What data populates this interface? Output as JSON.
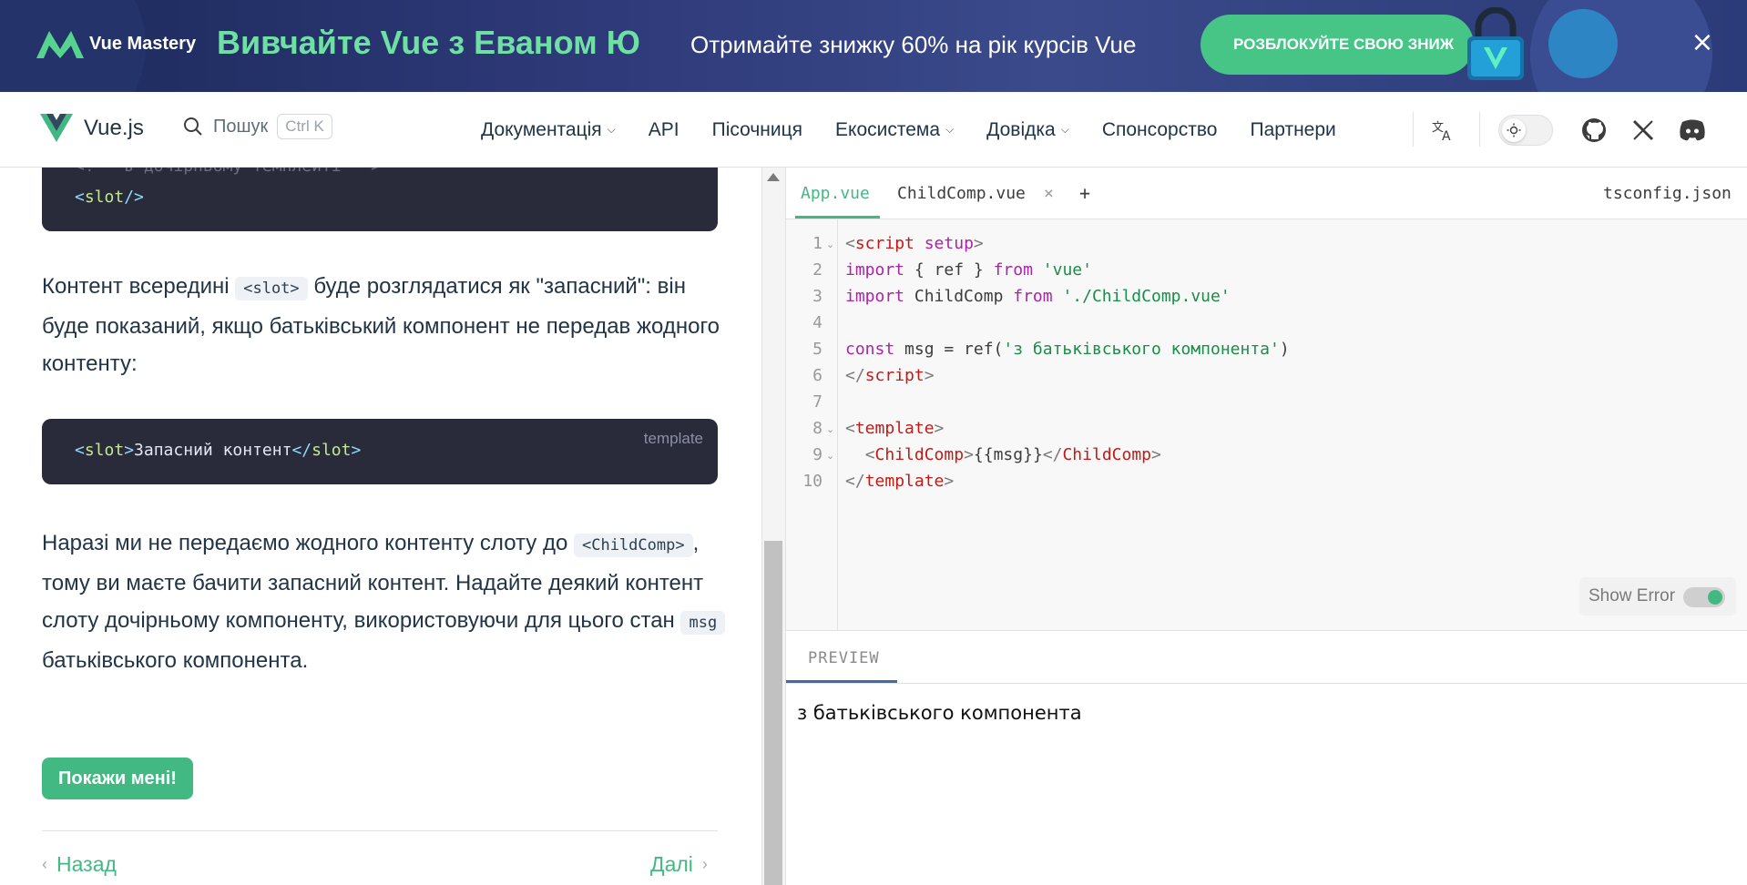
{
  "banner": {
    "logo_text": "Vue Mastery",
    "title": "Вивчайте Vue з Еваном Ю",
    "promo": "Отримайте знижку 60% на рік курсів Vue",
    "cta": "РОЗБЛОКУЙТЕ СВОЮ ЗНИЖ",
    "close": "×"
  },
  "nav": {
    "brand": "Vue.js",
    "search_label": "Пошук",
    "search_kbd": "Ctrl K",
    "menu": [
      {
        "label": "Документація",
        "dropdown": true
      },
      {
        "label": "API",
        "dropdown": false
      },
      {
        "label": "Пісочниця",
        "dropdown": false
      },
      {
        "label": "Екосистема",
        "dropdown": true
      },
      {
        "label": "Довідка",
        "dropdown": true
      },
      {
        "label": "Спонсорство",
        "dropdown": false
      },
      {
        "label": "Партнери",
        "dropdown": false
      }
    ]
  },
  "doc": {
    "code1_comment": "<!-- в дочірньому темплейті -->",
    "code1_open": "<",
    "code1_tag": "slot",
    "code1_close": "/>",
    "para1_a": "Контент всередині",
    "para1_code": "<slot>",
    "para1_b": "буде розглядатися як \"запасний\": він буде показаний, якщо батьківський компонент не передав жодного контенту:",
    "code2_lang": "template",
    "code2_tag": "slot",
    "code2_text": "Запасний контент",
    "para2_a": "Наразі ми не передаємо жодного контенту слоту до",
    "para2_code1": "<ChildComp>",
    "para2_b": ", тому ви маєте бачити запасний контент. Надайте деякий контент слоту дочірньому компоненту, використовуючи для цього стан",
    "para2_code2": "msg",
    "para2_c": "батьківського компонента.",
    "show_button": "Покажи мені!",
    "prev": "Назад",
    "next": "Далі"
  },
  "editor": {
    "tabs": [
      "App.vue",
      "ChildComp.vue"
    ],
    "tab_close": "×",
    "tab_add": "+",
    "tsconfig": "tsconfig.json",
    "line_numbers": [
      "1",
      "2",
      "3",
      "4",
      "5",
      "6",
      "7",
      "8",
      "9",
      "10"
    ],
    "show_error": "Show Error"
  },
  "code": {
    "l1_tag": "script",
    "l1_attr": "setup",
    "l2_import": "import",
    "l2_mid": " { ref } ",
    "l2_from": "from",
    "l2_str": "'vue'",
    "l3_import": "import",
    "l3_mid": " ChildComp ",
    "l3_from": "from",
    "l3_str": "'./ChildComp.vue'",
    "l5_const": "const",
    "l5_mid": " msg = ref(",
    "l5_str": "'з батьківського компонента'",
    "l5_end": ")",
    "l6_tag": "script",
    "l8_tag": "template",
    "l9_tag": "ChildComp",
    "l9_expr": "{{msg}}",
    "l10_tag": "template"
  },
  "preview": {
    "tab": "PREVIEW",
    "output": "з батьківського компонента"
  },
  "colors": {
    "vue_green": "#42b883",
    "banner_title": "#6fe0a3",
    "code_bg": "#292b3b"
  }
}
